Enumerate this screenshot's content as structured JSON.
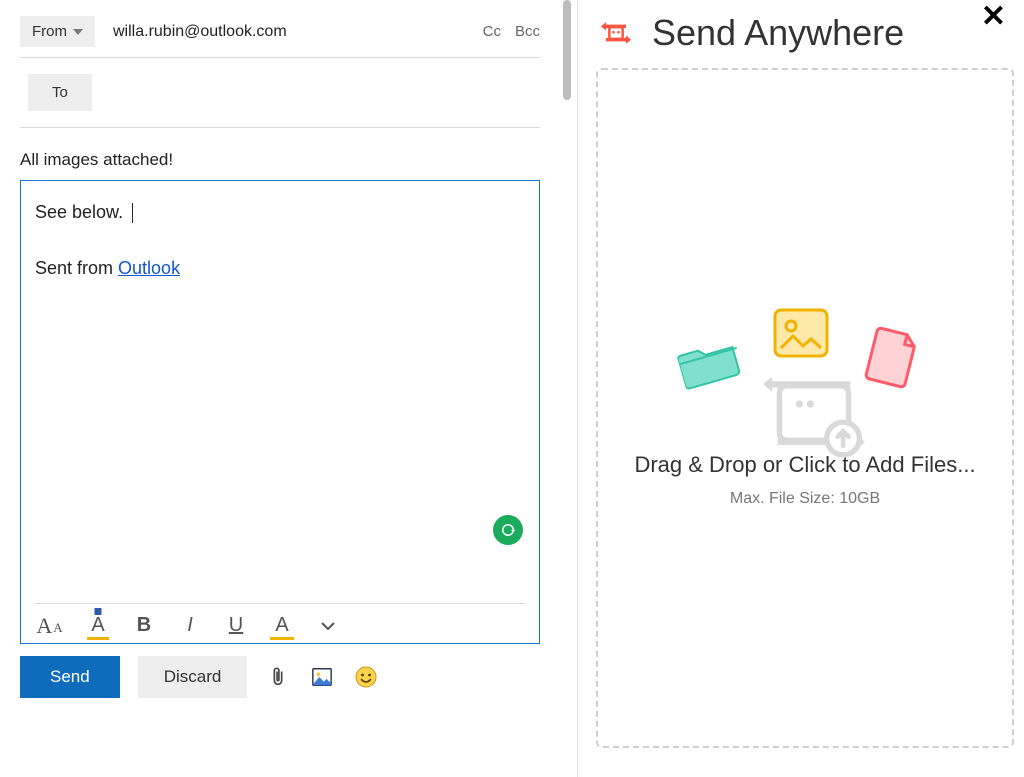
{
  "compose": {
    "from_label": "From",
    "from_email": "willa.rubin@outlook.com",
    "cc_label": "Cc",
    "bcc_label": "Bcc",
    "to_label": "To",
    "subject": "All images attached!",
    "body_line1": "See below.",
    "signature_prefix": "Sent from ",
    "signature_link": "Outlook"
  },
  "toolbar": {
    "send": "Send",
    "discard": "Discard"
  },
  "send_anywhere": {
    "title": "Send Anywhere",
    "drop_message": "Drag & Drop or Click to Add Files...",
    "max_size": "Max. File Size: 10GB"
  }
}
